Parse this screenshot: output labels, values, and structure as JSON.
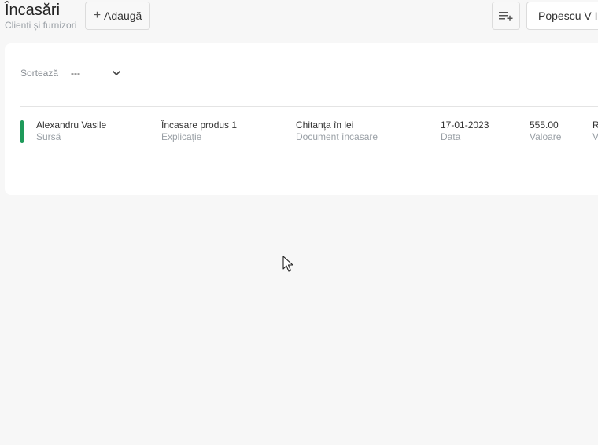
{
  "header": {
    "title": "Încasări",
    "subtitle": "Clienți și furnizori",
    "add_label": "Adaugă",
    "user_label": "Popescu V Io"
  },
  "sort": {
    "label": "Sortează",
    "value": "---"
  },
  "rows": [
    {
      "source": "Alexandru Vasile",
      "source_label": "Sursă",
      "explanation": "Încasare produs 1",
      "explanation_label": "Explicație",
      "document": "Chitanța în lei",
      "document_label": "Document încasare",
      "date": "17-01-2023",
      "date_label": "Data",
      "amount": "555.00",
      "amount_label": "Valoare",
      "extra": "R",
      "extra_label": "V",
      "status_color": "#1e9a5a"
    }
  ],
  "icons": {
    "add": "plus-icon",
    "list_add": "playlist-add-icon",
    "sort_dropdown": "chevron-down-icon",
    "cursor": "mouse-pointer-icon"
  }
}
